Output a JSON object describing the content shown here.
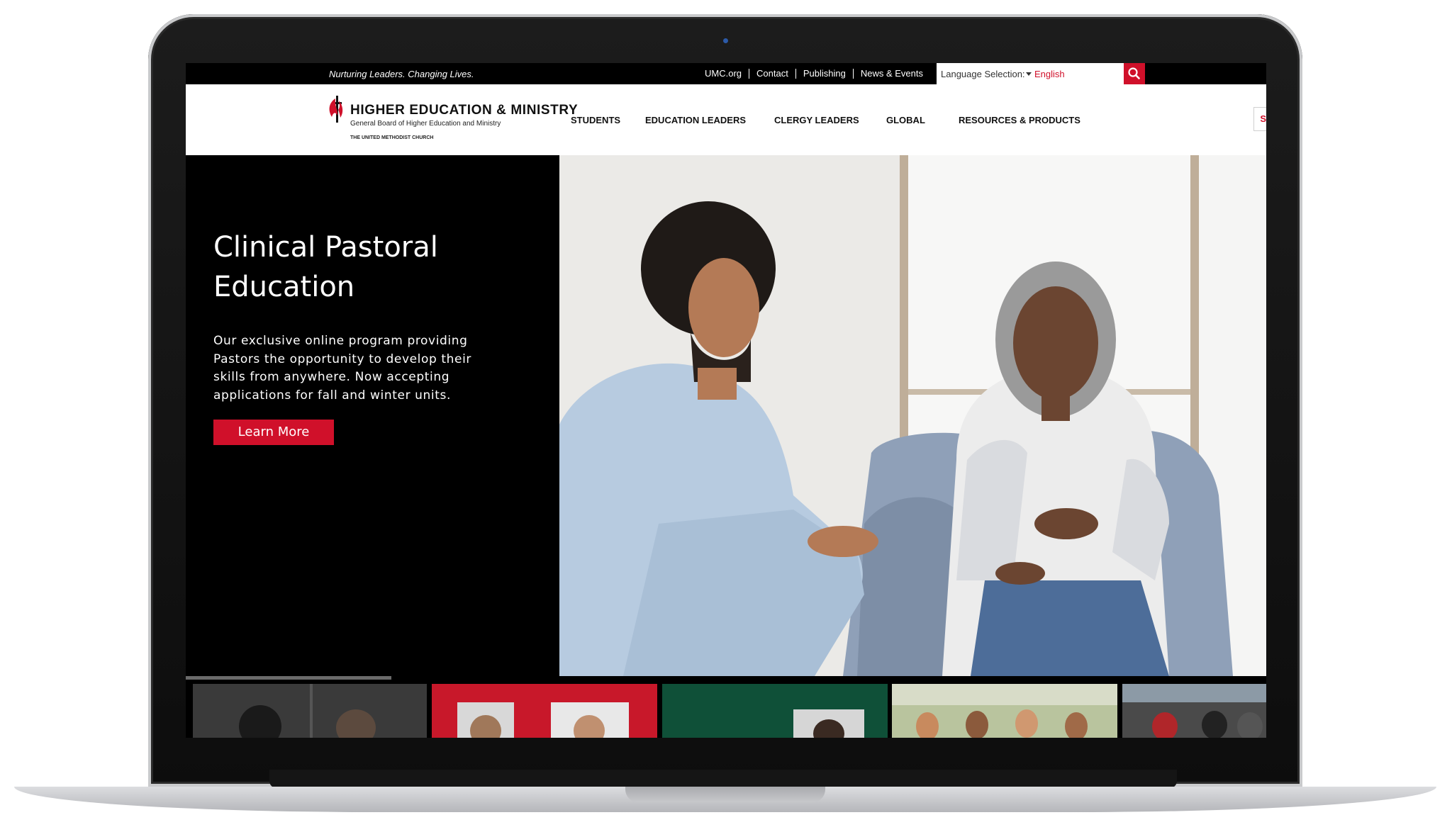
{
  "utility_bar": {
    "tagline": "Nurturing Leaders. Changing Lives.",
    "links": [
      "UMC.org",
      "Contact",
      "Publishing",
      "News & Events"
    ],
    "language_label": "Language Selection:",
    "language_value": "English",
    "search_icon": "search-icon"
  },
  "logo": {
    "title": "HIGHER EDUCATION & MINISTRY",
    "subtitle": "General Board of Higher Education and Ministry",
    "church": "THE UNITED METHODIST CHURCH",
    "icon": "cross-and-flame-icon"
  },
  "nav": {
    "items": [
      "STUDENTS",
      "EDUCATION LEADERS",
      "CLERGY LEADERS",
      "GLOBAL",
      "RESOURCES & PRODUCTS"
    ],
    "highlight": "SCHOLARSHIPS"
  },
  "hero": {
    "title": "Clinical Pastoral Education",
    "description": "Our exclusive online program providing Pastors the opportunity to develop their skills from anywhere. Now accepting applications for fall and winter units.",
    "button_label": "Learn More",
    "slider_progress": 0.19
  },
  "colors": {
    "brand_red": "#d0102a",
    "black": "#000000",
    "white": "#ffffff"
  }
}
